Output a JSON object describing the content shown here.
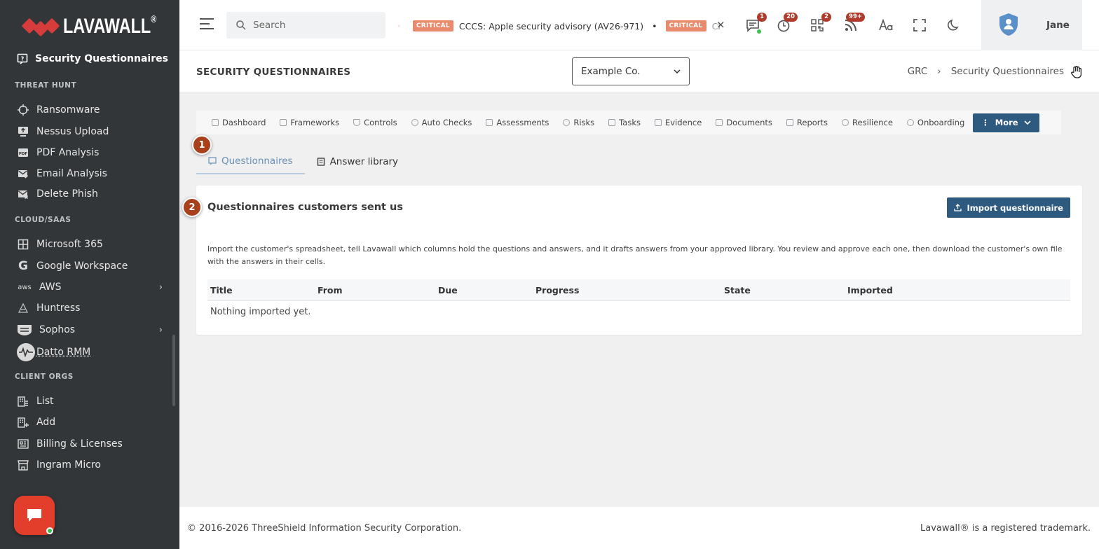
{
  "brand": {
    "name": "LAVAWALL",
    "mark": "®"
  },
  "sidebar": {
    "current": "Security Questionnaires",
    "sections": [
      {
        "title": "THREAT HUNT",
        "items": [
          "Ransomware",
          "Nessus Upload",
          "PDF Analysis",
          "Email Analysis",
          "Delete Phish"
        ]
      },
      {
        "title": "CLOUD/SAAS",
        "items": [
          "Microsoft 365",
          "Google Workspace",
          "AWS",
          "Huntress",
          "Sophos",
          "Datto RMM"
        ]
      },
      {
        "title": "CLIENT ORGS",
        "items": [
          "List",
          "Add",
          "Billing & Licenses",
          "Ingram Micro"
        ]
      }
    ]
  },
  "topbar": {
    "search_placeholder": "Search",
    "ticker": [
      {
        "badge": "CRITICAL",
        "text": "CCCS: Apple security advisory (AV26-971)"
      },
      {
        "badge": "CRITICAL",
        "text": "CI"
      }
    ],
    "ticker_separator": "•",
    "close_glyph": "×",
    "notifications": {
      "messages": "1",
      "alerts": "20",
      "qr": "2",
      "feeds": "99+"
    },
    "user_name": "Jane"
  },
  "page": {
    "title": "SECURITY QUESTIONNAIRES",
    "org_selected": "Example Co.",
    "breadcrumb": [
      "GRC",
      "›",
      "Security Questionnaires"
    ]
  },
  "tabs": [
    "Dashboard",
    "Frameworks",
    "Controls",
    "Auto Checks",
    "Assessments",
    "Risks",
    "Tasks",
    "Evidence",
    "Documents",
    "Reports",
    "Resilience",
    "Onboarding"
  ],
  "more_label": "More",
  "markers": [
    "1",
    "2"
  ],
  "subtabs": [
    "Questionnaires",
    "Answer library"
  ],
  "card": {
    "title": "Questionnaires customers sent us",
    "import_label": "Import questionnaire",
    "description": "Import the customer's spreadsheet, tell Lavawall which columns hold the questions and answers, and it drafts answers from your approved library. You review and approve each one, then download the customer's own file with the answers in their cells.",
    "columns": [
      "Title",
      "From",
      "Due",
      "Progress",
      "State",
      "Imported"
    ],
    "empty": "Nothing imported yet."
  },
  "footer": {
    "copyright": "© 2016-2026 ThreeShield Information Security Corporation.",
    "trademark": "Lavawall® is a registered trademark."
  },
  "colors": {
    "sidebar": "#333638",
    "accent": "#2f5a80",
    "critical": "#e88a6b",
    "marker": "#a8401c",
    "chat": "#e33d2c"
  }
}
